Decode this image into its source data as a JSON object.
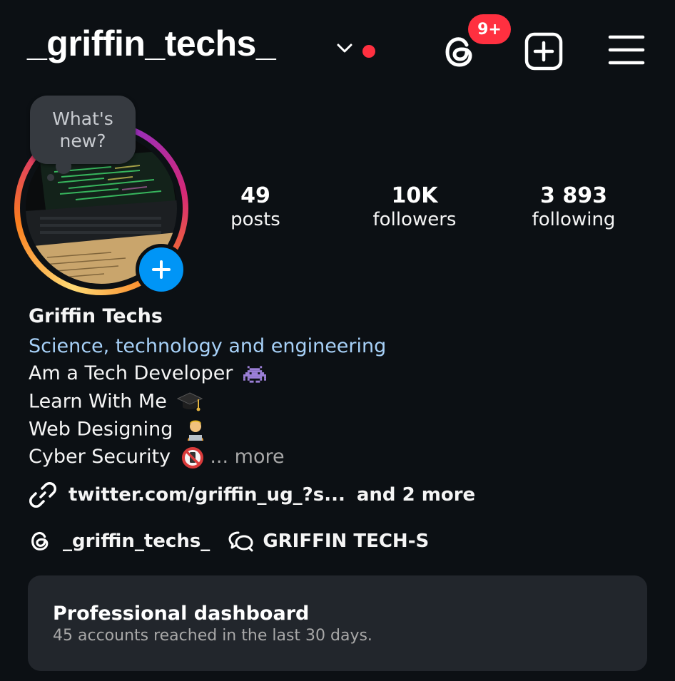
{
  "header": {
    "username": "_griffin_techs_",
    "threads_badge": "9+"
  },
  "profile": {
    "note_text": "What's new?",
    "stats": [
      {
        "value": "49",
        "label": "posts"
      },
      {
        "value": "10K",
        "label": "followers"
      },
      {
        "value": "3 893",
        "label": "following"
      }
    ],
    "full_name": "Griffin Techs",
    "category": "Science, technology and engineering",
    "bio_lines": [
      {
        "text": "Am a Tech Developer",
        "emoji": "space-invader"
      },
      {
        "text": "Learn With Me",
        "emoji": "graduation-cap"
      },
      {
        "text": "Web Designing",
        "emoji": "technologist"
      },
      {
        "text": "Cyber Security",
        "emoji": "no-mobile-phones"
      }
    ],
    "bio_ellipsis": "...",
    "bio_more": "more",
    "link_text": "twitter.com/griffin_ug_?s...",
    "link_more": "and 2 more",
    "threads_handle": "_griffin_techs_",
    "channel_name": "GRIFFIN TECH-S"
  },
  "dashboard": {
    "title": "Professional dashboard",
    "subtitle": "45 accounts reached in the last 30 days."
  },
  "colors": {
    "background": "#0c1014",
    "badge_red": "#ff3040",
    "link_blue": "#a7d1f8",
    "story_add_blue": "#0095f6",
    "card_bg": "#22262c"
  }
}
